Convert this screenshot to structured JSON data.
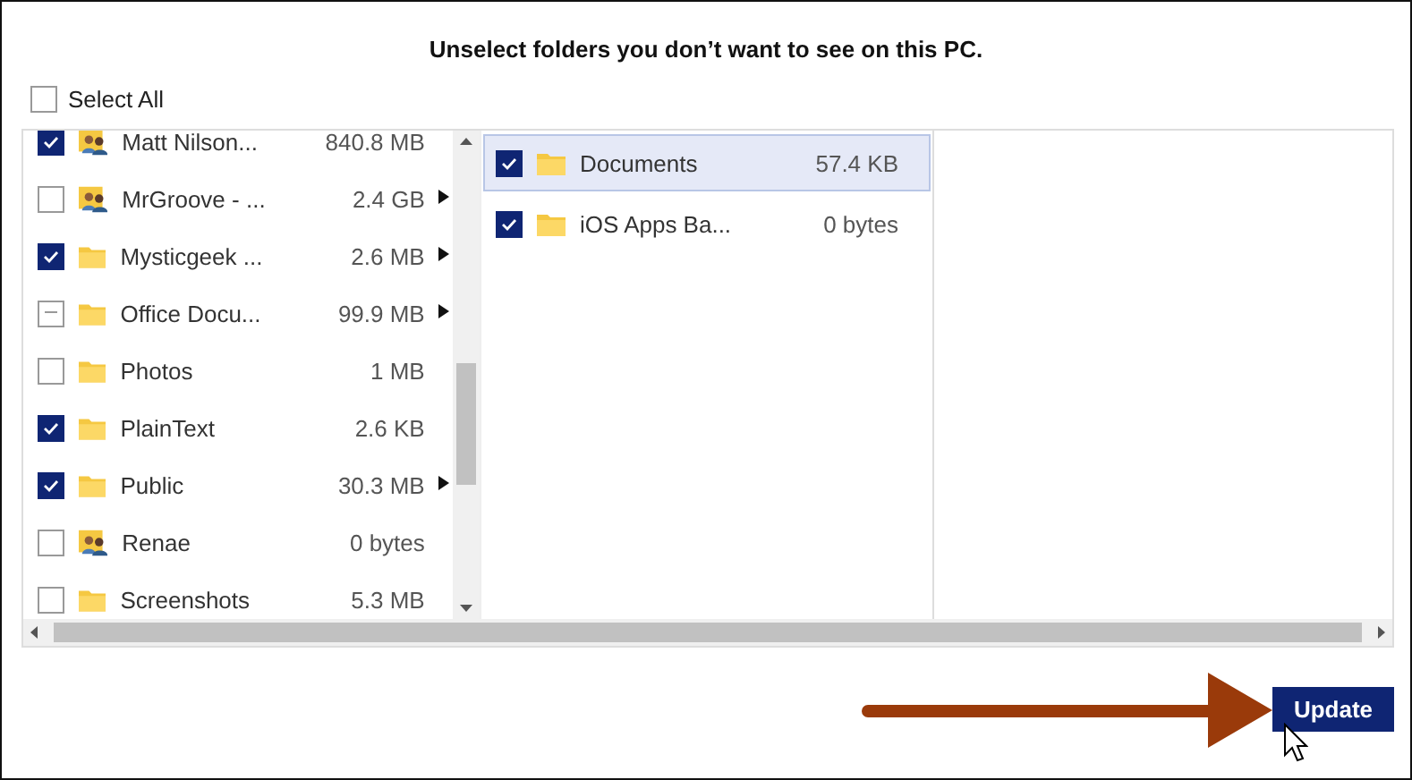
{
  "heading": "Unselect folders you don’t want to see on this PC.",
  "select_all": {
    "label": "Select All",
    "checked": false
  },
  "folders": [
    {
      "name": "Matt Nilson...",
      "size": "840.8 MB",
      "kind": "shared",
      "checked": true,
      "indeterminate": false,
      "expandable": false
    },
    {
      "name": "MrGroove - ...",
      "size": "2.4 GB",
      "kind": "shared",
      "checked": false,
      "indeterminate": false,
      "expandable": true
    },
    {
      "name": "Mysticgeek ...",
      "size": "2.6 MB",
      "kind": "folder",
      "checked": true,
      "indeterminate": false,
      "expandable": true
    },
    {
      "name": "Office Docu...",
      "size": "99.9 MB",
      "kind": "folder",
      "checked": false,
      "indeterminate": true,
      "expandable": true
    },
    {
      "name": "Photos",
      "size": "1 MB",
      "kind": "folder",
      "checked": false,
      "indeterminate": false,
      "expandable": false
    },
    {
      "name": "PlainText",
      "size": "2.6 KB",
      "kind": "folder",
      "checked": true,
      "indeterminate": false,
      "expandable": false
    },
    {
      "name": "Public",
      "size": "30.3 MB",
      "kind": "folder",
      "checked": true,
      "indeterminate": false,
      "expandable": true
    },
    {
      "name": "Renae",
      "size": "0 bytes",
      "kind": "shared",
      "checked": false,
      "indeterminate": false,
      "expandable": false
    },
    {
      "name": "Screenshots",
      "size": "5.3 MB",
      "kind": "folder",
      "checked": false,
      "indeterminate": false,
      "expandable": false
    }
  ],
  "subfolders": [
    {
      "name": "Documents",
      "size": "57.4 KB",
      "checked": true,
      "selected": true
    },
    {
      "name": "iOS Apps Ba...",
      "size": "0 bytes",
      "checked": true,
      "selected": false
    }
  ],
  "update_button": "Update"
}
